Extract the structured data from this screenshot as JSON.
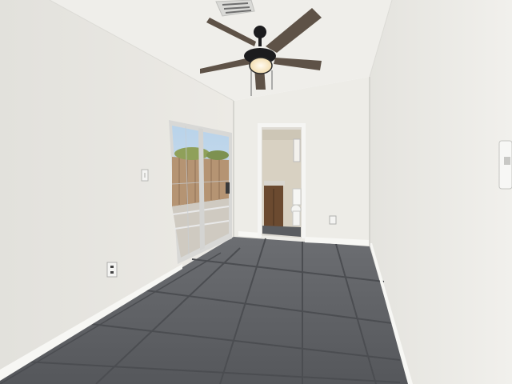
{
  "scene": {
    "description_visible_text": "",
    "palette": {
      "wall_left": "#e6e5e0",
      "wall_back": "#ecebe6",
      "wall_right": "#e9e8e3",
      "ceiling": "#f0efea",
      "floor": "#5f6165",
      "grout": "#4a4c50",
      "baseboard": "#f7f7f4",
      "fan_blade": "#5e5247",
      "fan_metal": "#1c1c1e",
      "fan_light": "#fff3d6",
      "door_frame": "#d8d8d6",
      "outdoor_sky": "#a9c7e4",
      "outdoor_fence": "#b49273",
      "bathroom_wall": "#d9d2c3",
      "vanity": "#6b4a30"
    },
    "items": [
      "ceiling-fan-with-light",
      "ceiling-vent",
      "sliding-glass-door",
      "light-switch",
      "electrical-outlet",
      "bathroom-doorway",
      "bathroom-vanity",
      "toilet",
      "tile-floor",
      "baseboards"
    ]
  }
}
